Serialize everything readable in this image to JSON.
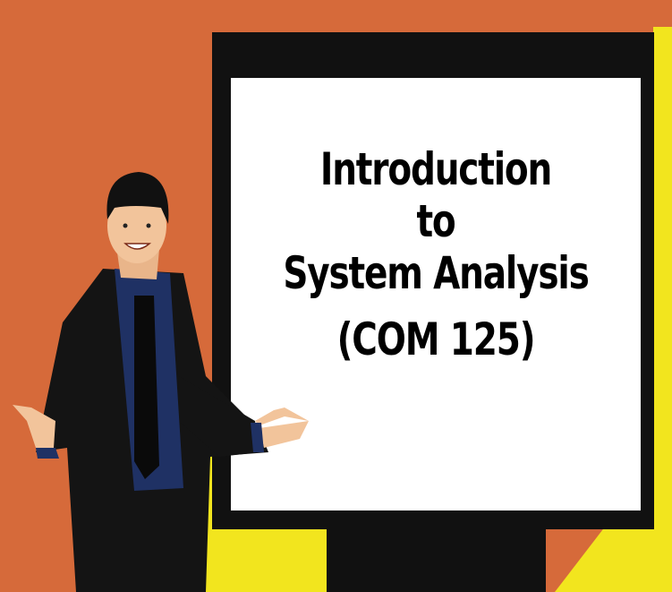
{
  "slide": {
    "title_line_1": "Introduction",
    "title_line_2": "to",
    "title_line_3": "System Analysis",
    "course_code": "(COM 125)"
  },
  "colors": {
    "wall": "#D66A3A",
    "floor": "#F2E51E",
    "board_frame": "#111111",
    "board_surface": "#FFFFFF",
    "suit": "#141414",
    "shirt": "#1F3164",
    "skin": "#F2C49B",
    "hair": "#111111"
  },
  "icons": {
    "presenter": "presenter-figure-icon"
  }
}
